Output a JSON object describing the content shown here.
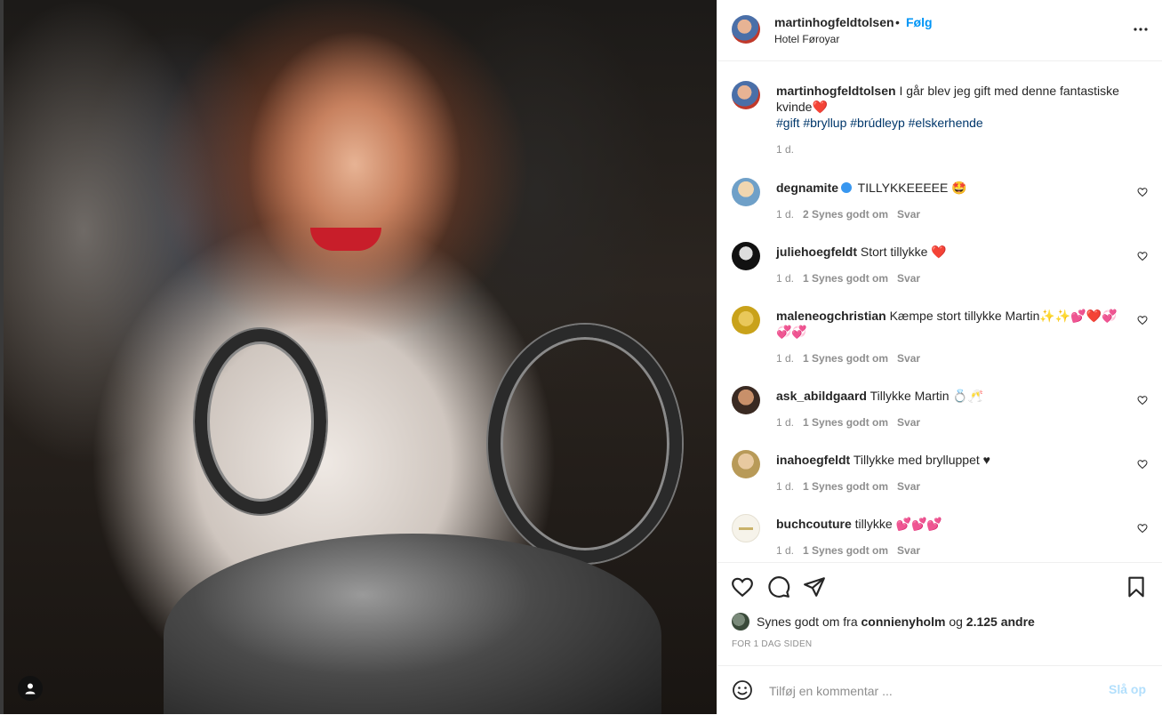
{
  "post": {
    "header": {
      "username": "martinhogfeldtolsen",
      "dot": "•",
      "follow_label": "Følg",
      "location": "Hotel Føroyar",
      "more_icon": "more-horizontal-icon"
    },
    "caption": {
      "username": "martinhogfeldtolsen",
      "text": "I går blev jeg gift med denne fantastiske kvinde❤️",
      "hashtags": "#gift #bryllup #brúdleyp #elskerhende",
      "time": "1 d."
    },
    "comments": [
      {
        "username": "degnamite",
        "verified": true,
        "text": "TILLYKKEEEEE 🤩",
        "time": "1 d.",
        "likes": "2 Synes godt om",
        "reply": "Svar"
      },
      {
        "username": "juliehoegfeldt",
        "verified": false,
        "text": "Stort tillykke ❤️",
        "time": "1 d.",
        "likes": "1 Synes godt om",
        "reply": "Svar"
      },
      {
        "username": "maleneogchristian",
        "verified": false,
        "text": "Kæmpe stort tillykke Martin✨✨💕❤️💞💞💞",
        "time": "1 d.",
        "likes": "1 Synes godt om",
        "reply": "Svar"
      },
      {
        "username": "ask_abildgaard",
        "verified": false,
        "text": "Tillykke Martin 💍🥂",
        "time": "1 d.",
        "likes": "1 Synes godt om",
        "reply": "Svar"
      },
      {
        "username": "inahoegfeldt",
        "verified": false,
        "text": "Tillykke med brylluppet ♥",
        "time": "1 d.",
        "likes": "1 Synes godt om",
        "reply": "Svar"
      },
      {
        "username": "buchcouture",
        "verified": false,
        "text": "tillykke 💕💕💕",
        "time": "1 d.",
        "likes": "1 Synes godt om",
        "reply": "Svar"
      }
    ],
    "likes_line": {
      "prefix": "Synes godt om fra",
      "user": "connienyholm",
      "and": "og",
      "others": "2.125 andre"
    },
    "timestamp": "FOR 1 DAG SIDEN",
    "composer": {
      "placeholder": "Tilføj en kommentar ...",
      "post_label": "Slå op"
    }
  },
  "colors": {
    "accent": "#0095f6",
    "text": "#262626",
    "muted": "#8e8e8e",
    "hashtag": "#00376b",
    "post_disabled": "#b2dffc"
  }
}
